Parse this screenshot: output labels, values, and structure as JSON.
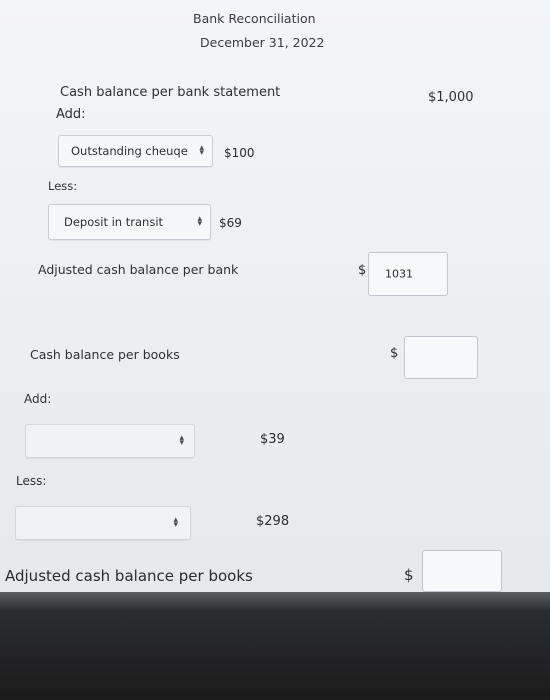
{
  "header": {
    "title": "Bank Reconciliation",
    "date": "December 31, 2022"
  },
  "bank": {
    "cash_balance_label": "Cash balance per bank statement",
    "cash_balance_value": "$1,000",
    "add_label": "Add:",
    "add_item": {
      "selected": "Outstanding cheuqe",
      "amount": "$100"
    },
    "less_label": "Less:",
    "less_item": {
      "selected": "Deposit in transit",
      "amount": "$69"
    },
    "adjusted_label": "Adjusted cash balance per bank",
    "adjusted_currency": "$",
    "adjusted_value": "1031"
  },
  "books": {
    "cash_balance_label": "Cash balance per books",
    "cash_balance_currency": "$",
    "cash_balance_value": "",
    "add_label": "Add:",
    "add_item": {
      "selected": "",
      "amount": "$39"
    },
    "less_label": "Less:",
    "less_item": {
      "selected": "",
      "amount": "$298"
    },
    "adjusted_label": "Adjusted cash balance per books",
    "adjusted_currency": "$",
    "adjusted_value": ""
  },
  "icons": {
    "select_arrow": "updown-chevron-icon"
  }
}
